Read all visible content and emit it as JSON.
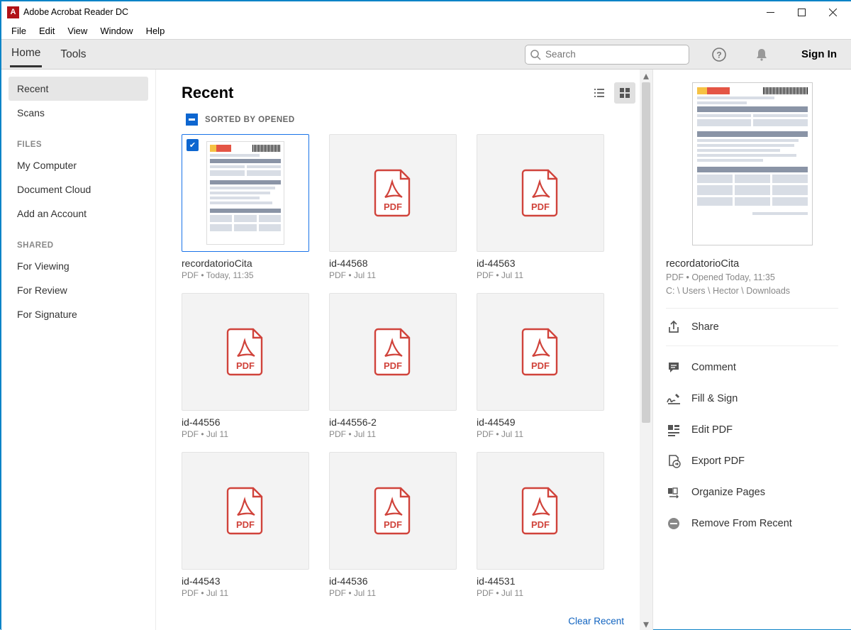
{
  "window": {
    "title": "Adobe Acrobat Reader DC",
    "icon_letter": "A"
  },
  "menubar": [
    "File",
    "Edit",
    "View",
    "Window",
    "Help"
  ],
  "tabs": {
    "home": "Home",
    "tools": "Tools"
  },
  "search": {
    "placeholder": "Search"
  },
  "header": {
    "signin": "Sign In"
  },
  "sidebar": {
    "items_top": [
      {
        "label": "Recent",
        "active": true
      },
      {
        "label": "Scans",
        "active": false
      }
    ],
    "heading_files": "FILES",
    "items_files": [
      {
        "label": "My Computer"
      },
      {
        "label": "Document Cloud"
      },
      {
        "label": "Add an Account"
      }
    ],
    "heading_shared": "SHARED",
    "items_shared": [
      {
        "label": "For Viewing"
      },
      {
        "label": "For Review"
      },
      {
        "label": "For Signature"
      }
    ]
  },
  "main": {
    "title": "Recent",
    "sort_label": "SORTED BY OPENED",
    "clear_recent": "Clear Recent",
    "files": [
      {
        "name": "recordatorioCita",
        "meta": "PDF  •  Today, 11:35",
        "selected": true,
        "hasPreview": true
      },
      {
        "name": "id-44568",
        "meta": "PDF  •  Jul 11",
        "selected": false
      },
      {
        "name": "id-44563",
        "meta": "PDF  •  Jul 11",
        "selected": false
      },
      {
        "name": "id-44556",
        "meta": "PDF  •  Jul 11",
        "selected": false
      },
      {
        "name": "id-44556-2",
        "meta": "PDF  •  Jul 11",
        "selected": false
      },
      {
        "name": "id-44549",
        "meta": "PDF  •  Jul 11",
        "selected": false
      },
      {
        "name": "id-44543",
        "meta": "PDF  •  Jul 11",
        "selected": false
      },
      {
        "name": "id-44536",
        "meta": "PDF  •  Jul 11",
        "selected": false
      },
      {
        "name": "id-44531",
        "meta": "PDF  •  Jul 11",
        "selected": false
      }
    ]
  },
  "detail": {
    "name": "recordatorioCita",
    "meta1": "PDF  •  Opened Today, 11:35",
    "meta2": "C: \\ Users \\ Hector \\ Downloads",
    "actions": {
      "share": "Share",
      "comment": "Comment",
      "fillsign": "Fill & Sign",
      "edit": "Edit PDF",
      "export": "Export PDF",
      "organize": "Organize Pages",
      "remove": "Remove From Recent"
    }
  }
}
